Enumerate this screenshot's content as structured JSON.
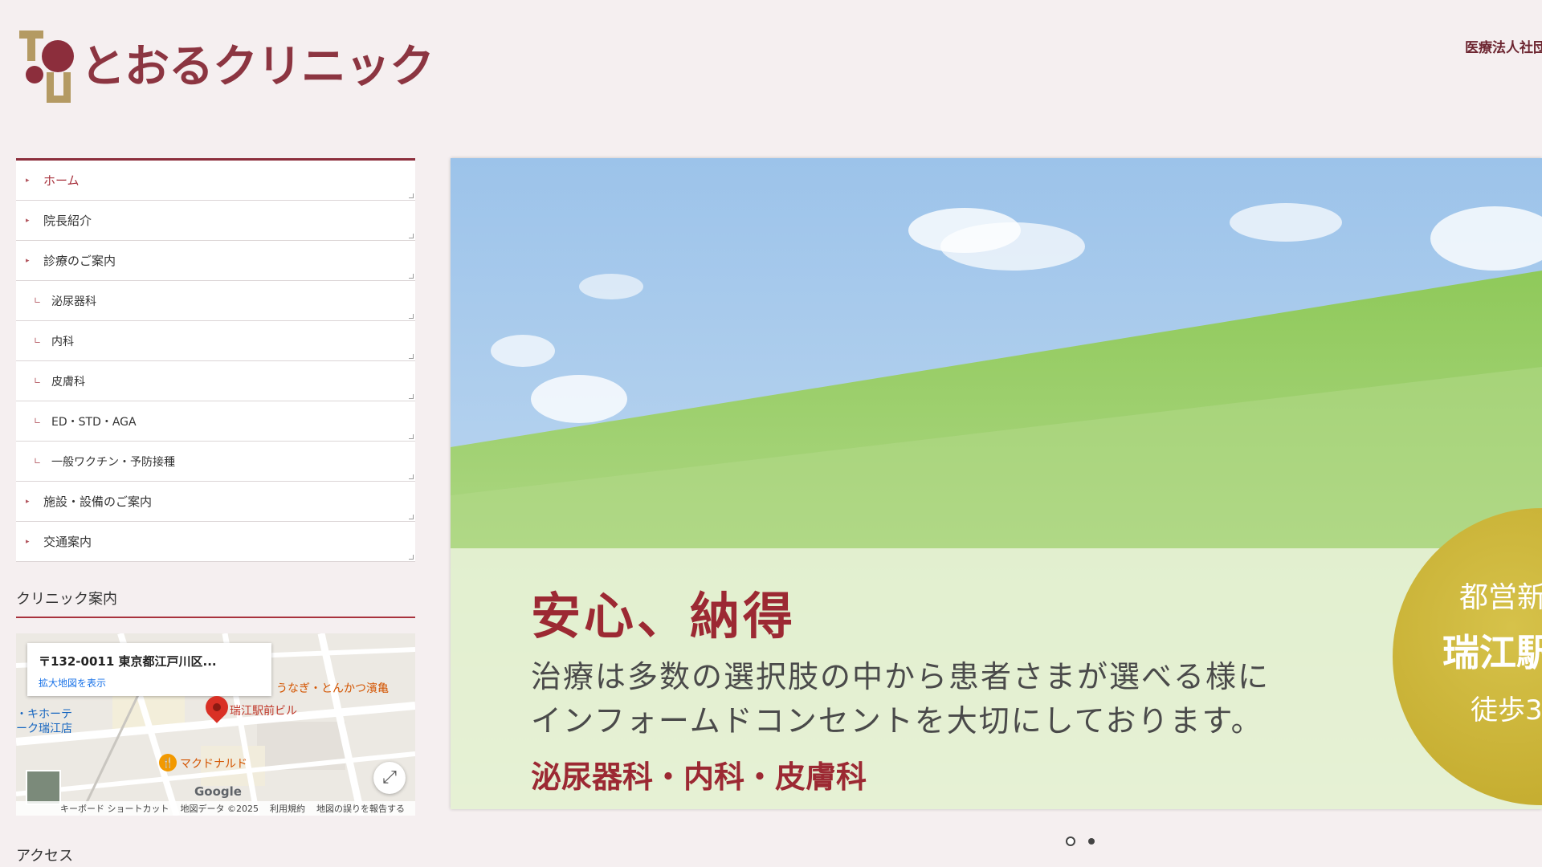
{
  "header": {
    "logo_text": "とおるクリニック",
    "corporation": "医療法人社団"
  },
  "nav": {
    "items": [
      {
        "label": "ホーム",
        "type": "top",
        "active": true
      },
      {
        "label": "院長紹介",
        "type": "top"
      },
      {
        "label": "診療のご案内",
        "type": "top"
      },
      {
        "label": "泌尿器科",
        "type": "sub"
      },
      {
        "label": "内科",
        "type": "sub"
      },
      {
        "label": "皮膚科",
        "type": "sub"
      },
      {
        "label": "ED・STD・AGA",
        "type": "sub"
      },
      {
        "label": "一般ワクチン・予防接種",
        "type": "sub"
      },
      {
        "label": "施設・設備のご案内",
        "type": "top"
      },
      {
        "label": "交通案内",
        "type": "top"
      }
    ],
    "arrow_glyph": "▸",
    "sub_glyph": "∟"
  },
  "clinic_info": {
    "title": "クリニック案内",
    "map": {
      "address": "〒132-0011 東京都江戸川区...",
      "enlarge_link": "拡大地図を表示",
      "labels": {
        "restaurant": "うなぎ・とんかつ濱亀",
        "building": "瑞江駅前ビル",
        "store_1": "・キホーテ",
        "store_2": "ーク瑞江店",
        "mcdonalds": "マクドナルド",
        "google": "Google"
      },
      "footer": [
        "キーボード ショートカット",
        "地図データ ©2025",
        "利用規約",
        "地図の誤りを報告する"
      ]
    }
  },
  "access": {
    "title": "アクセス"
  },
  "hero": {
    "heading": "安心、納得",
    "subtitle_line1": "治療は多数の選択肢の中から患者さまが選べる様に",
    "subtitle_line2": "インフォームドコンセントを大切にしております。",
    "departments": "泌尿器科・内科・皮膚科",
    "badge": {
      "line1": "都営新",
      "line2": "瑞江駅",
      "line3": "徒歩3"
    },
    "slide_count": 2,
    "active_slide": 1
  },
  "colors": {
    "brand": "#8c2e3c",
    "gold": "#b49a63",
    "background": "#f5eff0",
    "badge": "#c8ae33"
  }
}
